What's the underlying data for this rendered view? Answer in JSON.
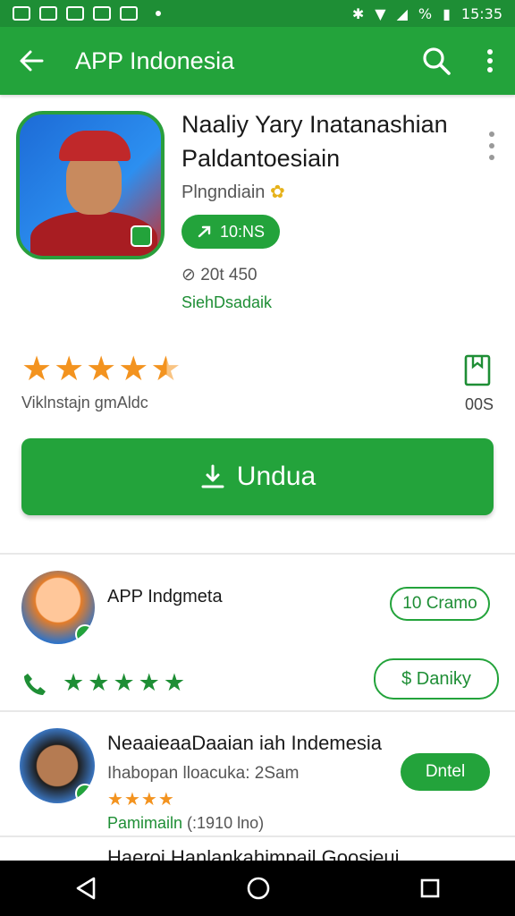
{
  "status_bar": {
    "time": "15:35",
    "battery": "%"
  },
  "app_bar": {
    "title": "APP Indonesia"
  },
  "app": {
    "title": "Naaliy Yary Inatanashian Paldantoesiain",
    "developer": "Plngndiain",
    "pill_label": "10:NS",
    "downloads": "20t 450",
    "category": "SiehDsadaik",
    "rating_text": "Viklnstajn gmAldc",
    "bookmark_count": "00S",
    "install_label": "Undua"
  },
  "cards": [
    {
      "name": "APP Indgmeta",
      "button1": "10 Cramo",
      "button2": "$ Daniky"
    },
    {
      "title": "NeaaieaaDaaian iah Indemesia",
      "subtitle": "Ihabopan lloacuka: 2Sam",
      "meta": "Pamimailn",
      "meta_paren": "(:1910 lno)",
      "button": "Dntel"
    },
    {
      "title": "Haeroi Hanlankahimpail Goosieui"
    }
  ],
  "colors": {
    "primary": "#23a33b",
    "primary_dark": "#1e8e35",
    "star_orange": "#f3931f"
  }
}
